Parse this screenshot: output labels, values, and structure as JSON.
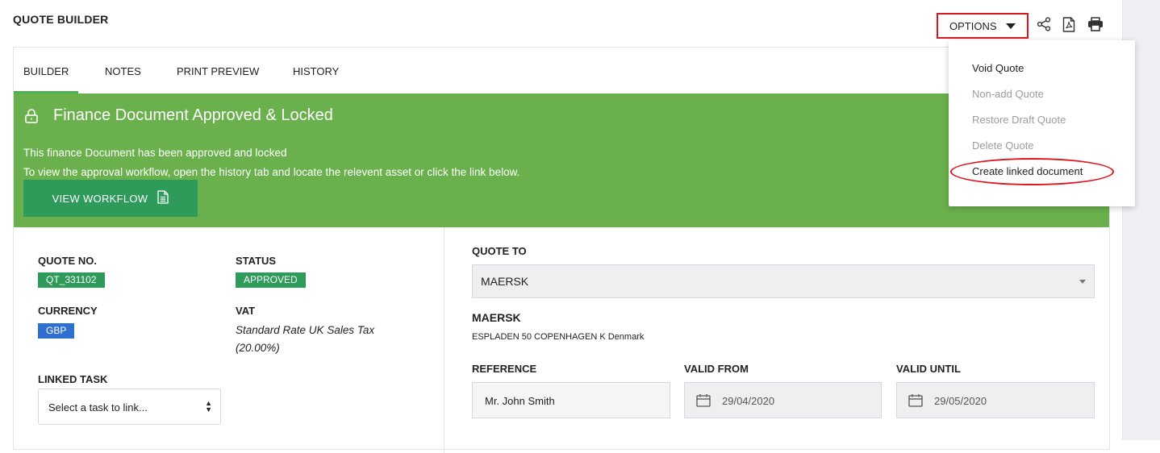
{
  "header": {
    "title": "QUOTE BUILDER",
    "options_label": "OPTIONS"
  },
  "toolbar": {
    "icons": [
      "share-icon",
      "pdf-icon",
      "print-icon"
    ]
  },
  "tabs": [
    {
      "label": "BUILDER",
      "active": true
    },
    {
      "label": "NOTES",
      "active": false
    },
    {
      "label": "PRINT PREVIEW",
      "active": false
    },
    {
      "label": "HISTORY",
      "active": false
    }
  ],
  "banner": {
    "title": "Finance Document Approved & Locked",
    "line1": "This finance Document has been approved and locked",
    "line2": "To view the approval workflow, open the history tab and locate the relevent asset or click the link below.",
    "button_label": "VIEW WORKFLOW",
    "color": "#6ab04c"
  },
  "details": {
    "quote_no_label": "QUOTE NO.",
    "quote_no": "QT_331102",
    "status_label": "STATUS",
    "status": "APPROVED",
    "currency_label": "CURRENCY",
    "currency": "GBP",
    "vat_label": "VAT",
    "vat": "Standard Rate UK Sales Tax (20.00%)",
    "linked_task_label": "LINKED TASK",
    "linked_task_placeholder": "Select a task to link..."
  },
  "quote_to": {
    "label": "QUOTE TO",
    "selected": "MAERSK",
    "company": "MAERSK",
    "address": "ESPLADEN 50 COPENHAGEN K Denmark"
  },
  "fields": {
    "reference_label": "REFERENCE",
    "reference": "Mr. John Smith",
    "valid_from_label": "VALID FROM",
    "valid_from": "29/04/2020",
    "valid_until_label": "VALID UNTIL",
    "valid_until": "29/05/2020"
  },
  "options_menu": [
    {
      "label": "Void Quote",
      "enabled": true
    },
    {
      "label": "Non-add Quote",
      "enabled": false
    },
    {
      "label": "Restore Draft Quote",
      "enabled": false
    },
    {
      "label": "Delete Quote",
      "enabled": false
    },
    {
      "label": "Create linked document",
      "enabled": true
    }
  ]
}
